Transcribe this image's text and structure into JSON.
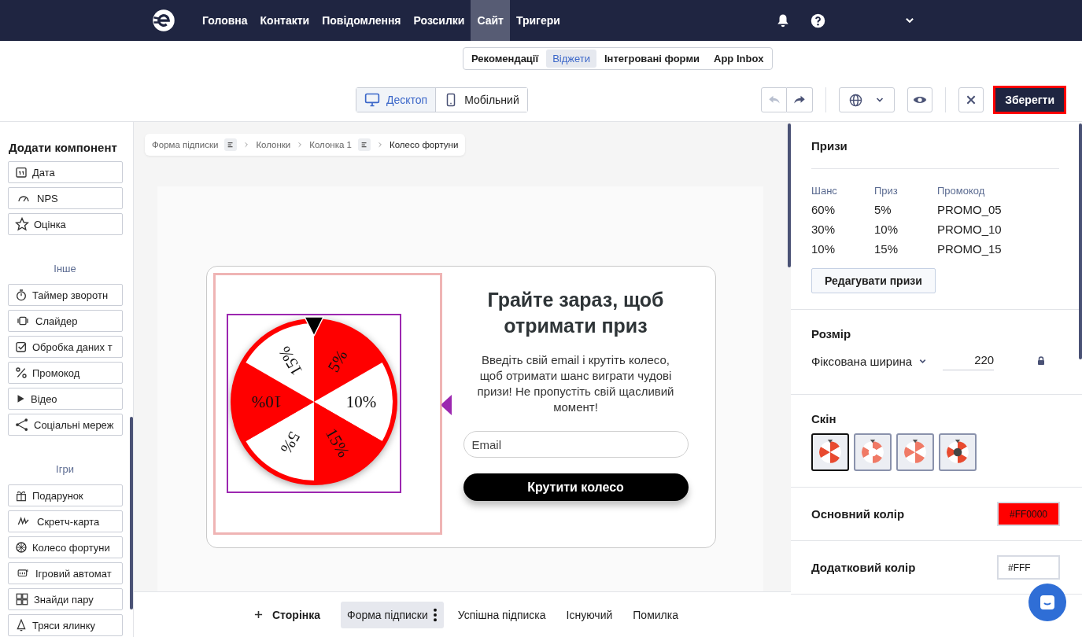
{
  "nav": {
    "items": [
      {
        "label": "Головна",
        "selected": false
      },
      {
        "label": "Контакти",
        "selected": false
      },
      {
        "label": "Повідомлення",
        "selected": false
      },
      {
        "label": "Розсилки",
        "selected": false
      },
      {
        "label": "Сайт",
        "selected": true
      },
      {
        "label": "Тригери",
        "selected": false
      }
    ]
  },
  "subtabs": [
    {
      "label": "Рекомендації",
      "selected": false
    },
    {
      "label": "Віджети",
      "selected": true
    },
    {
      "label": "Інтегровані форми",
      "selected": false
    },
    {
      "label": "App Inbox",
      "selected": false
    }
  ],
  "toolbar": {
    "devices": [
      {
        "label": "Десктоп",
        "selected": true
      },
      {
        "label": "Мобільний",
        "selected": false
      }
    ],
    "undo_disabled": true,
    "redo_disabled": false,
    "save": "Зберегти"
  },
  "sidebar": {
    "title": "Додати компонент",
    "groups": [
      {
        "items": [
          "Дата",
          "NPS",
          "Оцінка"
        ]
      },
      {
        "title": "Інше",
        "items": [
          "Таймер зворотн",
          "Слайдер",
          "Обробка даних т",
          "Промокод",
          "Відео",
          "Соціальні мереж"
        ]
      },
      {
        "title": "Ігри",
        "items": [
          "Подарунок",
          "Скретч-карта",
          "Колесо фортуни",
          "Ігровий автомат",
          "Знайди пару",
          "Тряси ялинку"
        ]
      }
    ]
  },
  "breadcrumb": [
    {
      "label": "Форма підписки",
      "has_menu": true,
      "current": false
    },
    {
      "label": "Колонки",
      "has_menu": false,
      "current": false
    },
    {
      "label": "Колонка 1",
      "has_menu": true,
      "current": false
    },
    {
      "label": "Колесо фортуни",
      "has_menu": false,
      "current": true
    }
  ],
  "form": {
    "heading": "Грайте зараз, щоб отримати приз",
    "text": "Введіть свій email і крутіть колесо, щоб отримати шанс виграти чудові призи! Не пропустіть свій щасливий момент!",
    "email_placeholder": "Email",
    "button": "Крутити колесо",
    "wheel": {
      "segments": [
        "5%",
        "10%",
        "15%",
        "5%",
        "10%",
        "15%"
      ]
    }
  },
  "pages": {
    "add": "Сторінка",
    "items": [
      {
        "label": "Форма підписки",
        "selected": true
      },
      {
        "label": "Успішна підписка",
        "selected": false
      },
      {
        "label": "Існуючий",
        "selected": false
      },
      {
        "label": "Помилка",
        "selected": false
      }
    ]
  },
  "panel": {
    "prizes": {
      "title": "Призи",
      "columns": [
        "Шанс",
        "Приз",
        "Промокод"
      ],
      "rows": [
        [
          "60%",
          "5%",
          "PROMO_05"
        ],
        [
          "30%",
          "10%",
          "PROMO_10"
        ],
        [
          "10%",
          "15%",
          "PROMO_15"
        ]
      ],
      "edit_button": "Редагувати призи"
    },
    "size": {
      "title": "Розмір",
      "mode": "Фіксована ширина",
      "value": "220"
    },
    "skin": {
      "title": "Скін",
      "options": [
        {
          "selected": true
        },
        {
          "selected": false
        },
        {
          "selected": false
        },
        {
          "selected": false
        }
      ]
    },
    "primary_color": {
      "label": "Основний колір",
      "value": "#FF0000"
    },
    "secondary_color": {
      "label": "Додатковий колір",
      "value": "#FFF"
    }
  }
}
